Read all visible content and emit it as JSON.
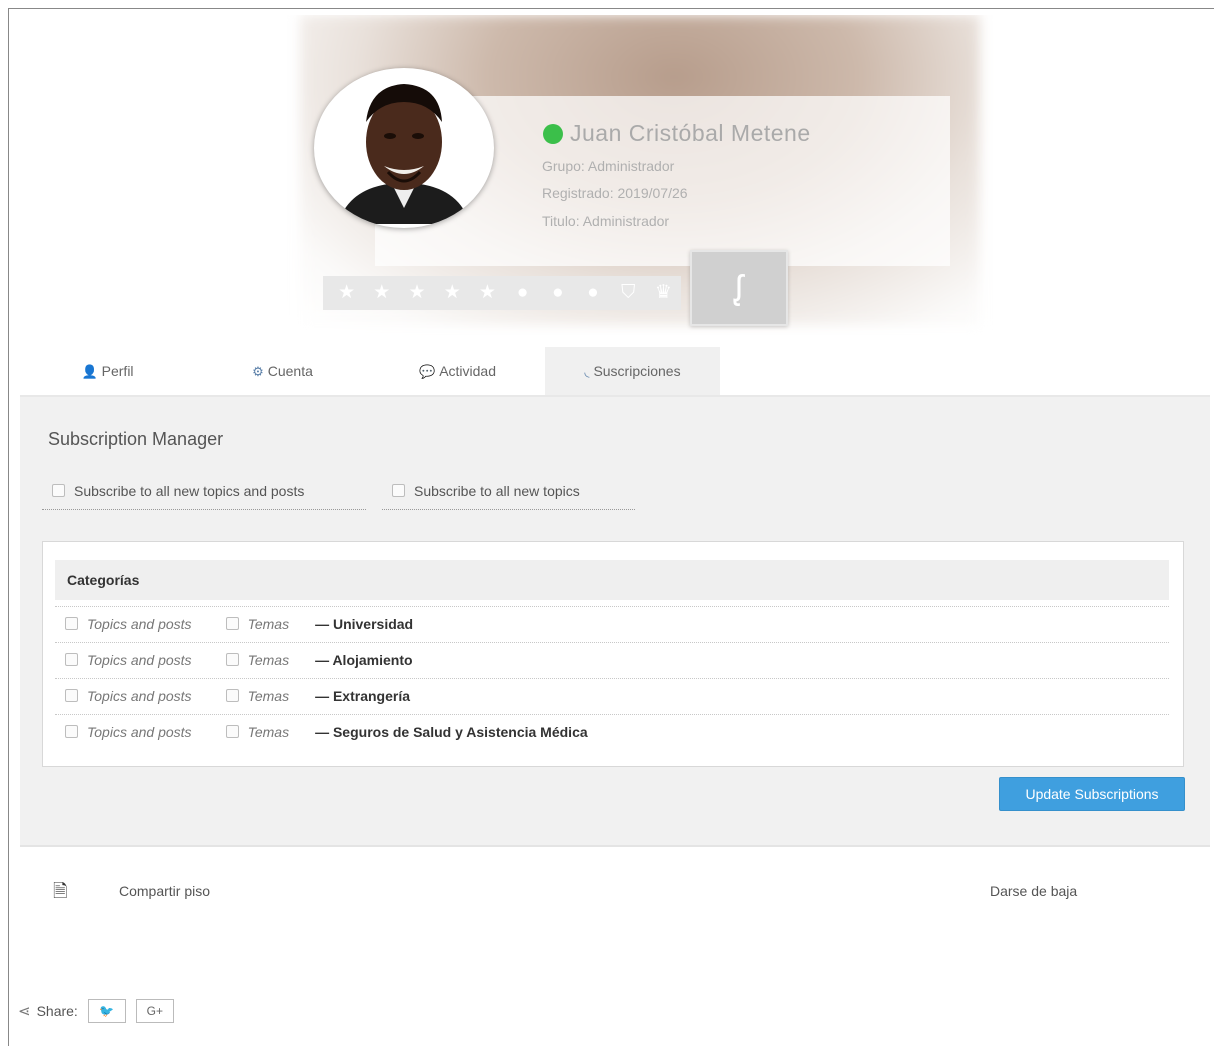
{
  "profile": {
    "name": "Juan Cristóbal Metene",
    "group": "Grupo: Administrador",
    "registered": "Registrado: 2019/07/26",
    "title": "Titulo: Administrador",
    "online_color": "#3bbf4a",
    "badges": [
      "star-icon",
      "star-icon",
      "star-icon",
      "star-icon",
      "star-icon",
      "circle-icon",
      "circle-icon",
      "circle-icon",
      "shield-icon",
      "trophy-icon"
    ]
  },
  "tabs": [
    {
      "label": "Perfil",
      "icon": "user-icon"
    },
    {
      "label": "Cuenta",
      "icon": "gear-icon"
    },
    {
      "label": "Actividad",
      "icon": "comments-icon"
    },
    {
      "label": "Suscripciones",
      "icon": "rss-icon"
    }
  ],
  "subscriptions": {
    "title": "Subscription Manager",
    "global_opt_all": "Subscribe to all new topics and posts",
    "global_opt_topics": "Subscribe to all new topics",
    "categories_header": "Categorías",
    "topics_posts_label": "Topics and posts",
    "topics_label": "Temas",
    "categories": [
      "— Universidad",
      "— Alojamiento",
      "— Extrangería",
      "— Seguros de Salud y Asistencia Médica"
    ],
    "update_button": "Update Subscriptions",
    "accent_color": "#3f9fdf"
  },
  "footer": {
    "topic_link": "Compartir piso",
    "unsubscribe": "Darse de baja",
    "share_label": "Share:",
    "twitter_label": "🐦",
    "gplus_label": "G+"
  }
}
